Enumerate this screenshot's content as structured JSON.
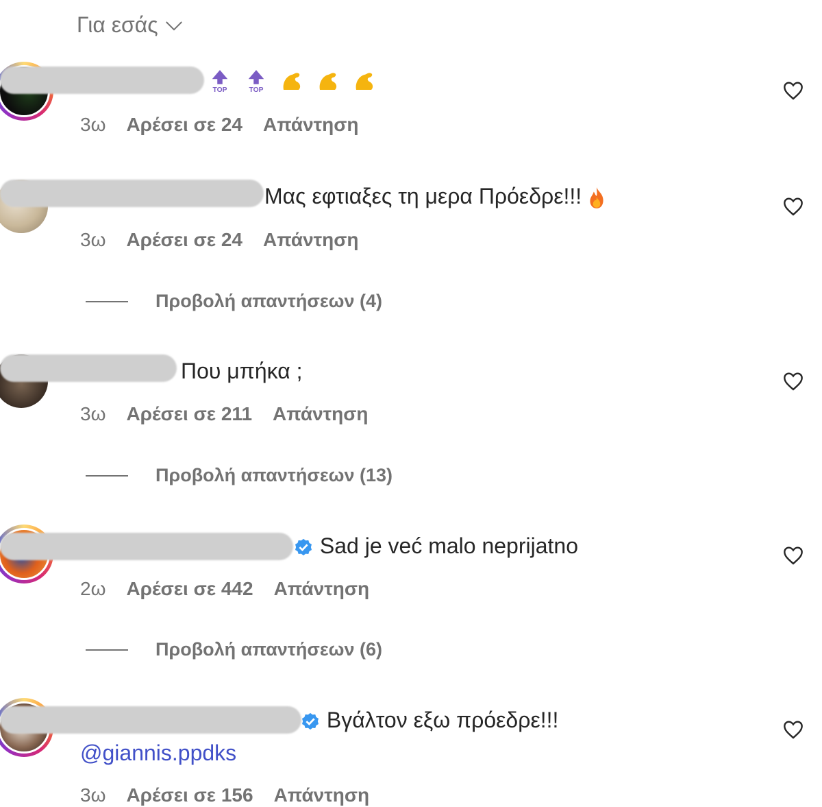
{
  "filter": {
    "label": "Για εσάς"
  },
  "comments": [
    {
      "text": "",
      "emojis": [
        "top-arrow",
        "top-arrow",
        "flexed-biceps",
        "flexed-biceps",
        "flexed-biceps"
      ],
      "age": "3ω",
      "likes": "Αρέσει σε 24",
      "reply": "Απάντηση"
    },
    {
      "text": "Μας εφτιαξες τη μερα Πρόεδρε!!!",
      "emojis": [
        "fire"
      ],
      "age": "3ω",
      "likes": "Αρέσει σε 24",
      "reply": "Απάντηση",
      "view_replies": "Προβολή απαντήσεων (4)"
    },
    {
      "text": "Που μπήκα ;",
      "age": "3ω",
      "likes": "Αρέσει σε 211",
      "reply": "Απάντηση",
      "view_replies": "Προβολή απαντήσεων (13)"
    },
    {
      "text": "Sad je već malo neprijatno",
      "verified": true,
      "age": "2ω",
      "likes": "Αρέσει σε 442",
      "reply": "Απάντηση",
      "view_replies": "Προβολή απαντήσεων (6)"
    },
    {
      "text": "Βγάλτον εξω πρόεδρε!!!",
      "verified": true,
      "mention": "@giannis.ppdks",
      "age": "3ω",
      "likes": "Αρέσει σε 156",
      "reply": "Απάντηση"
    }
  ],
  "colors": {
    "secondary_text": "#737373",
    "mention": "#4150c8",
    "verified": "#3897f0"
  }
}
